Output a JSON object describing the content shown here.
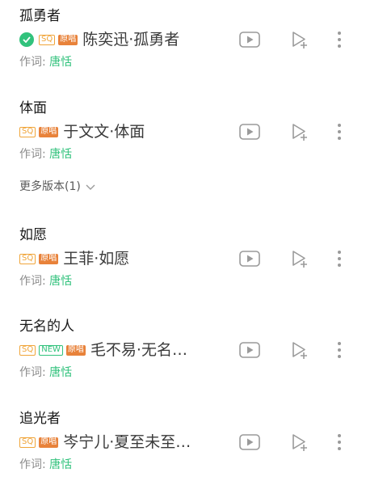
{
  "songs": [
    {
      "title": "孤勇者",
      "verified": true,
      "badges": {
        "sq": "SQ",
        "original": "原唱"
      },
      "artist_title": "陈奕迅·孤勇者",
      "lyricist_label": "作词:",
      "lyricist_name": "唐恬"
    },
    {
      "title": "体面",
      "badges": {
        "sq": "SQ",
        "original": "原唱"
      },
      "artist_title": "于文文·体面",
      "lyricist_label": "作词:",
      "lyricist_name": "唐恬",
      "more_versions": "更多版本(1)"
    },
    {
      "title": "如愿",
      "badges": {
        "sq": "SQ",
        "original": "原唱"
      },
      "artist_title": "王菲·如愿",
      "lyricist_label": "作词:",
      "lyricist_name": "唐恬"
    },
    {
      "title": "无名的人",
      "badges": {
        "sq": "SQ",
        "new": "NEW",
        "original": "原唱"
      },
      "artist_title": "毛不易·无名…",
      "lyricist_label": "作词:",
      "lyricist_name": "唐恬"
    },
    {
      "title": "追光者",
      "badges": {
        "sq": "SQ",
        "original": "原唱"
      },
      "artist_title": "岑宁儿·夏至未至…",
      "lyricist_label": "作词:",
      "lyricist_name": "唐恬"
    }
  ],
  "icons": {
    "verified": "check-circle-icon",
    "play_video": "play-video-icon",
    "add_to_playlist": "add-to-playlist-icon",
    "more": "more-vertical-icon",
    "expand": "chevron-down-icon"
  },
  "colors": {
    "accent_green": "#31c27c",
    "sq_orange": "#f0a53a",
    "original_badge": "#e8823a",
    "icon_gray": "#9a9a9a",
    "title_text": "#1a1a1a",
    "secondary_text": "#8c8c8c"
  }
}
